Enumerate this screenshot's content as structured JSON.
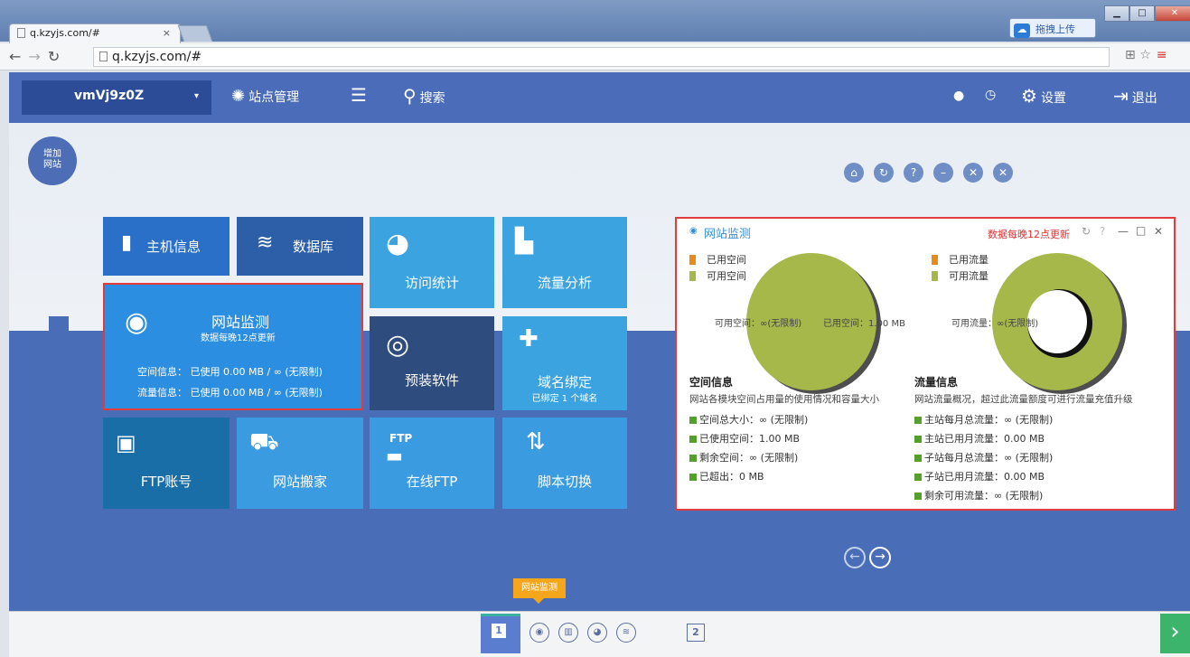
{
  "browser": {
    "tab_title": "q.kzyjs.com/#",
    "tab_close": "×",
    "url": "q.kzyjs.com/#",
    "upload_label": "拖拽上传",
    "win_min": "▁",
    "win_max": "□",
    "win_close": "✕"
  },
  "header": {
    "site_name": "vmVj9z0Z",
    "site_caret": "▾",
    "site_manage": "站点管理",
    "search": "搜索",
    "settings": "设置",
    "logout": "退出"
  },
  "add_site": {
    "line1": "增加",
    "line2": "网站"
  },
  "window_buttons": [
    "⌂",
    "↻",
    "?",
    "–",
    "✕",
    "✕"
  ],
  "tiles": {
    "host_info": "主机信息",
    "database": "数据库",
    "visit_stats": "访问统计",
    "traffic_analysis": "流量分析",
    "monitor_title": "网站监测",
    "monitor_sub": "数据每晚12点更新",
    "monitor_space": "空间信息： 已使用 0.00 MB / ∞ (无限制)",
    "monitor_traffic": "流量信息： 已使用 0.00 MB / ∞ (无限制)",
    "preinstall": "预装软件",
    "domain_bind": "域名绑定",
    "domain_bind_sub": "已绑定 1 个域名",
    "ftp_account": "FTP账号",
    "site_move": "网站搬家",
    "online_ftp": "在线FTP",
    "ftp_text": "FTP",
    "script_switch": "脚本切换"
  },
  "panel": {
    "title": "网站监测",
    "update_note": "数据每晚12点更新",
    "controls": [
      "↻",
      "?",
      "—",
      "□",
      "✕"
    ],
    "space_legend": [
      {
        "label": "已用空间",
        "color": "#e88a1c"
      },
      {
        "label": "可用空间",
        "color": "#a6b84a"
      }
    ],
    "traffic_legend": [
      {
        "label": "已用流量",
        "color": "#e88a1c"
      },
      {
        "label": "可用流量",
        "color": "#a6b84a"
      }
    ],
    "space_pie_label_left": "可用空间：∞(无限制)",
    "space_pie_label_right": "已用空间：1.00 MB",
    "traffic_pie_label": "可用流量：∞(无限制)",
    "space_info_title": "空间信息",
    "space_info_desc": "网站各模块空间占用量的使用情况和容量大小",
    "space_items": [
      "空间总大小：∞ (无限制)",
      "已使用空间：1.00 MB",
      "剩余空间：∞ (无限制)",
      "已超出：0 MB"
    ],
    "traffic_info_title": "流量信息",
    "traffic_info_desc": "网站流量概况，超过此流量额度可进行流量充值升级",
    "traffic_items": [
      "主站每月总流量：∞ (无限制)",
      "主站已用月流量：0.00 MB",
      "子站每月总流量：∞ (无限制)",
      "子站已用月流量：0.00 MB",
      "剩余可用流量：∞ (无限制)"
    ],
    "pie_color": "#a6b84a"
  },
  "pager": {
    "prev": "←",
    "next": "→"
  },
  "tooltip": "网站监测",
  "dock": {
    "page1": "1",
    "page2": "2",
    "next": "›"
  }
}
